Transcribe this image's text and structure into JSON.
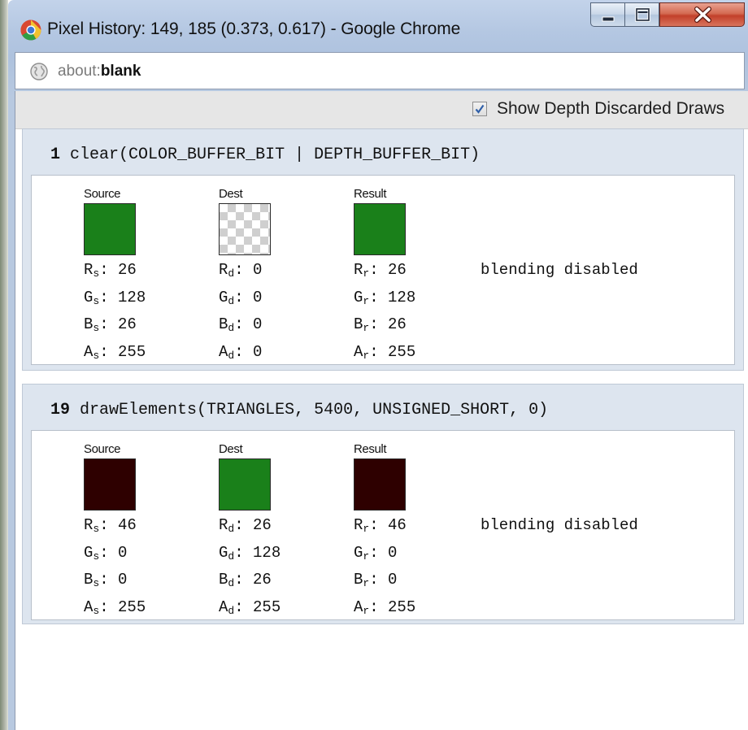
{
  "window": {
    "title": "Pixel History: 149, 185 (0.373, 0.617) - Google Chrome",
    "address_prefix": "about:",
    "address_host": "blank"
  },
  "toolbar": {
    "show_depth_discarded_label": "Show Depth Discarded Draws",
    "show_depth_discarded_checked": true
  },
  "entries": [
    {
      "number": "1",
      "call": "clear(COLOR_BUFFER_BIT | DEPTH_BUFFER_BIT)",
      "source": {
        "label": "Source",
        "color": "#1a801a",
        "r": "26",
        "g": "128",
        "b": "26",
        "a": "255"
      },
      "dest": {
        "label": "Dest",
        "transparent": true,
        "r": "0",
        "g": "0",
        "b": "0",
        "a": "0"
      },
      "result": {
        "label": "Result",
        "color": "#1a801a",
        "r": "26",
        "g": "128",
        "b": "26",
        "a": "255"
      },
      "blending": "blending disabled"
    },
    {
      "number": "19",
      "call": "drawElements(TRIANGLES, 5400, UNSIGNED_SHORT, 0)",
      "source": {
        "label": "Source",
        "color": "#2e0000",
        "r": "46",
        "g": "0",
        "b": "0",
        "a": "255"
      },
      "dest": {
        "label": "Dest",
        "color": "#1a801a",
        "r": "26",
        "g": "128",
        "b": "26",
        "a": "255"
      },
      "result": {
        "label": "Result",
        "color": "#2e0000",
        "r": "46",
        "g": "0",
        "b": "0",
        "a": "255"
      },
      "blending": "blending disabled"
    }
  ],
  "subscripts": {
    "source": "s",
    "dest": "d",
    "result": "r"
  },
  "channel_letters": [
    "R",
    "G",
    "B",
    "A"
  ],
  "icons": [
    "chrome-icon",
    "minimize-icon",
    "maximize-icon",
    "close-icon",
    "globe-icon",
    "checkmark-icon"
  ]
}
